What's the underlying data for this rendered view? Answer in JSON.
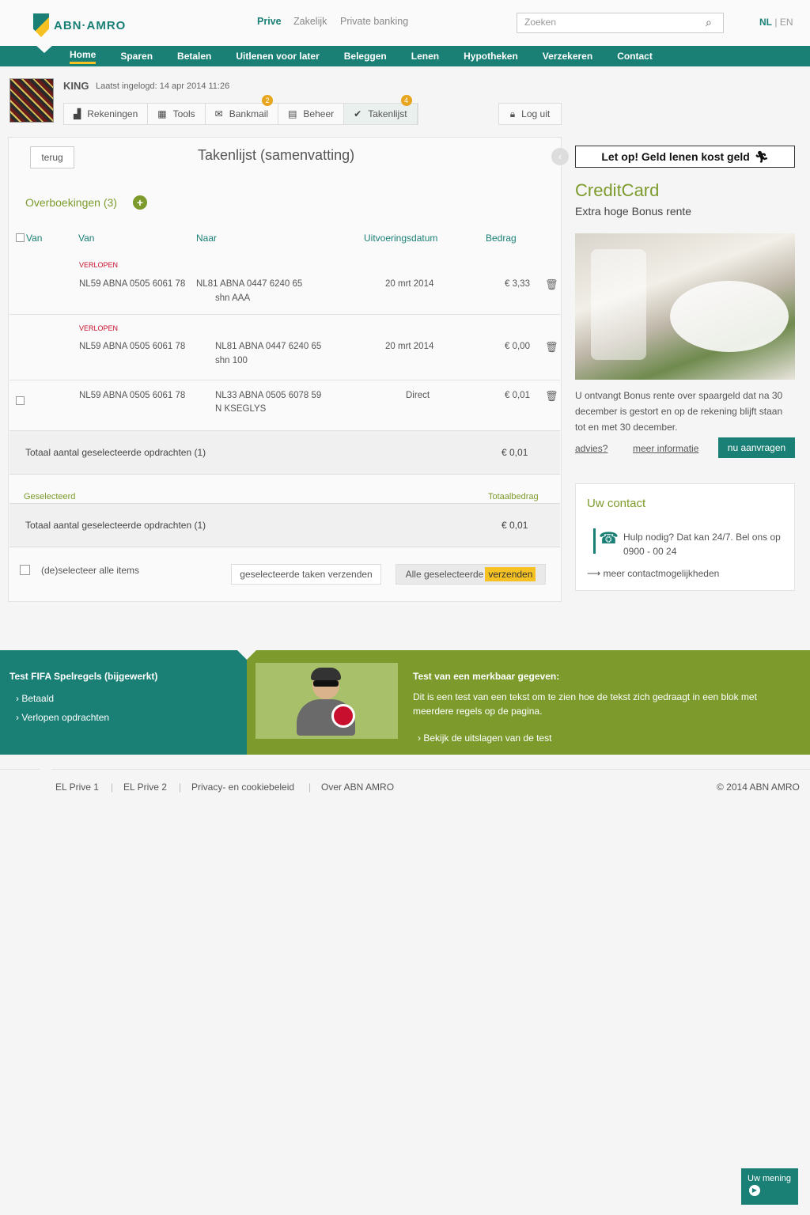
{
  "header": {
    "segments": [
      "Prive",
      "Zakelijk",
      "Private banking"
    ],
    "search_placeholder": "Zoeken",
    "lang_nl": "NL",
    "lang_sep": "|",
    "lang_en": "EN"
  },
  "mainnav": [
    "Home",
    "Sparen",
    "Betalen",
    "Uitlenen voor later",
    "Beleggen",
    "Lenen",
    "Hypotheken",
    "Verzekeren",
    "Contact"
  ],
  "user": {
    "name": "KING",
    "last_login": "Laatst ingelogd: 14 apr 2014 11:26"
  },
  "toolbar": {
    "items": [
      {
        "label": "Rekeningen",
        "icon": "bar-chart-icon",
        "badge": ""
      },
      {
        "label": "Tools",
        "icon": "grid-icon",
        "badge": ""
      },
      {
        "label": "Bankmail",
        "icon": "mail-icon",
        "badge": "2"
      },
      {
        "label": "Beheer",
        "icon": "manage-icon",
        "badge": ""
      },
      {
        "label": "Takenlijst",
        "icon": "check-icon",
        "badge": "4"
      }
    ],
    "logout": "Log uit"
  },
  "panel": {
    "back": "terug",
    "title": "Takenlijst (samenvatting)",
    "section": "Overboekingen (3)",
    "headers": {
      "van": "Van",
      "naar": "Naar",
      "datum": "Uitvoeringsdatum",
      "bedrag": "Bedrag"
    },
    "rows": [
      {
        "from_label": "VERLOPEN",
        "from": "NL59 ABNA 0505 6061 78",
        "to": "NL81 ABNA 0447 6240 65",
        "sub": "shn AAA",
        "date": "20 mrt 2014",
        "amount": "€ 3,33"
      },
      {
        "from_label": "VERLOPEN",
        "from": "NL59 ABNA 0505 6061 78",
        "to": "NL81 ABNA 0447 6240 65",
        "sub": "shn 100",
        "date": "20 mrt 2014",
        "amount": "€ 0,00"
      },
      {
        "from_label": "",
        "from": "NL59 ABNA 0505 6061 78",
        "to": "NL33 ABNA 0505 6078 59",
        "sub": "N KSEGLYS",
        "date": "Direct",
        "amount": "€ 0,01"
      }
    ],
    "total_text": "Totaal aantal geselecteerde opdrachten (1)",
    "total_amount": "€ 0,01",
    "selected_label": "Geselecteerd",
    "total_label": "Totaalbedrag",
    "total_text2": "Totaal aantal geselecteerde opdrachten (1)",
    "total_amount2": "€ 0,01",
    "select_all": "(de)selecteer alle items",
    "send_selected": "geselecteerde taken verzenden",
    "send_all_a": "Alle geselecteerde",
    "send_all_b": "verzenden"
  },
  "sidebar": {
    "promo": "Let op! Geld lenen kost geld",
    "cc_title": "CreditCard",
    "cc_sub": "Extra hoge Bonus rente",
    "cc_text": "U ontvangt Bonus rente over spaargeld dat na 30 december is gestort en op de rekening blijft staan tot en met 30 december.",
    "cc_advice": "advies?",
    "cc_more": "meer informatie",
    "cc_apply": "nu aanvragen",
    "contact_title": "Uw contact",
    "contact_text": "Hulp nodig? Dat kan 24/7. Bel ons op 0900 - 00 24",
    "contact_more": "meer contactmogelijkheden"
  },
  "band": {
    "left_title": "Test FIFA Spelregels (bijgewerkt)",
    "left_link1": "Betaald",
    "left_link2": "Verlopen opdrachten",
    "title": "Test van een merkbaar gegeven:",
    "text": "Dit is een test van een tekst om te zien hoe de tekst zich gedraagt in een blok met meerdere regels op de pagina.",
    "link": "Bekijk de uitslagen van de test"
  },
  "footer": {
    "links": [
      "EL Prive 1",
      "EL Prive 2",
      "Privacy- en cookiebeleid",
      "Over ABN AMRO"
    ],
    "copyright": "© 2014 ABN AMRO"
  },
  "feedback": "Uw mening",
  "colors": {
    "brand": "#1a7f75",
    "accent": "#f6c223",
    "green": "#7c9b2c"
  }
}
